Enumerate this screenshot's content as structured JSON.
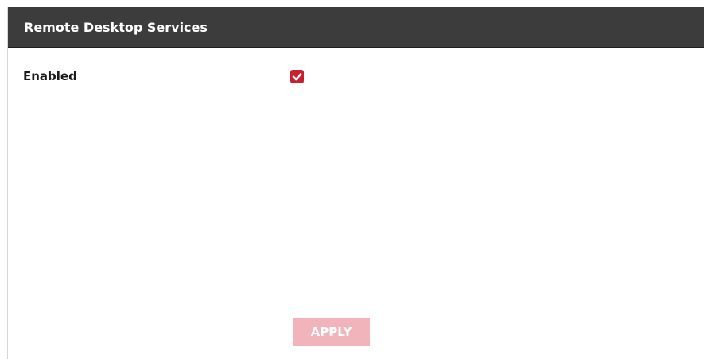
{
  "header": {
    "title": "Remote Desktop Services"
  },
  "settings": {
    "enabled_label": "Enabled",
    "enabled_checked": true
  },
  "actions": {
    "apply_label": "APPLY",
    "apply_disabled": true
  },
  "colors": {
    "header_background": "#3c3c3c",
    "checkbox_accent": "#c8202f",
    "apply_disabled_background": "#f1b4ba"
  },
  "icons": {
    "checkbox_mark": "check-icon"
  }
}
